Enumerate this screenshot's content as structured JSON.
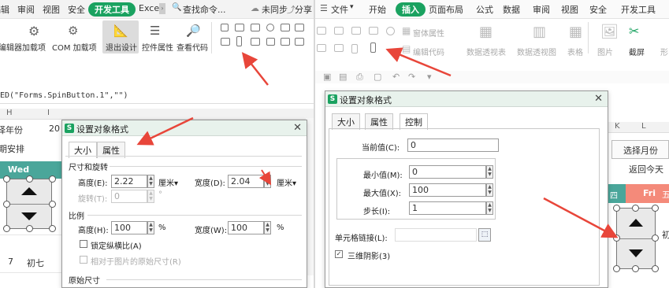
{
  "left": {
    "tabs": [
      "编辑",
      "审阅",
      "视图",
      "安全",
      "开发工具",
      "Exce"
    ],
    "search_label": "查找命令...",
    "sync_label": "未同步",
    "share_label": "分享",
    "ribbon": {
      "partial": "编辑器",
      "addins": "加载项",
      "com_addins": "COM 加载项",
      "exit_design": "退出设计",
      "control_props": "控件属性",
      "view_code": "查看代码"
    },
    "formula": "ED(\"Forms.SpinButton.1\",\"\")",
    "sheet": {
      "col_h": "H",
      "col_i": "I",
      "select_year": "择年份",
      "year_value": "20",
      "schedule": "期安排",
      "wed": "Wed",
      "row_num": "7",
      "day_label": "初七"
    },
    "dialog": {
      "title": "设置对象格式",
      "tabs": [
        "大小",
        "属性"
      ],
      "section_size": "尺寸和旋转",
      "height_label": "高度(E):",
      "height_value": "2.22",
      "height_unit": "厘米▾",
      "width_label": "宽度(D):",
      "width_value": "2.04",
      "width_unit": "厘米▾",
      "rotation_label": "旋转(T):",
      "rotation_value": "0",
      "rotation_unit": "°",
      "section_scale": "比例",
      "scale_h_label": "高度(H):",
      "scale_h_value": "100",
      "scale_w_label": "宽度(W):",
      "scale_w_value": "100",
      "percent": "%",
      "lock_aspect": "锁定纵横比(A)",
      "relative_original": "相对于图片的原始尺寸(R)",
      "section_original": "原始尺寸"
    }
  },
  "right": {
    "tabs": [
      "文件",
      "开始",
      "插入",
      "页面布局",
      "公式",
      "数据",
      "审阅",
      "视图",
      "安全",
      "开发工具"
    ],
    "ribbon": {
      "form_props": "窗体属性",
      "edit_code": "编辑代码",
      "pivot_table": "数据透视表",
      "pivot_chart": "数据透视图",
      "table": "表格",
      "picture": "图片",
      "screenshot": "截屏",
      "shape_partial": "形"
    },
    "sheet": {
      "col_l": "L",
      "col_k": "K",
      "select_month": "选择月份",
      "back_today": "返回今天",
      "thu_partial": "四",
      "fri": "Fri",
      "fri_partial": "五",
      "side_char": "初"
    },
    "dialog": {
      "title": "设置对象格式",
      "tabs": [
        "大小",
        "属性",
        "控制"
      ],
      "current_label": "当前值(C):",
      "current_value": "0",
      "min_label": "最小值(M):",
      "min_value": "0",
      "max_label": "最大值(X):",
      "max_value": "100",
      "step_label": "步长(I):",
      "step_value": "1",
      "cell_link_label": "单元格链接(L):",
      "cell_link_value": "",
      "shade_3d": "三维阴影(3)"
    }
  },
  "colors": {
    "accent_green": "#1aa260",
    "header_teal": "#4aa69a",
    "fri_header": "#f48a7a",
    "arrow_red": "#e8463a"
  }
}
